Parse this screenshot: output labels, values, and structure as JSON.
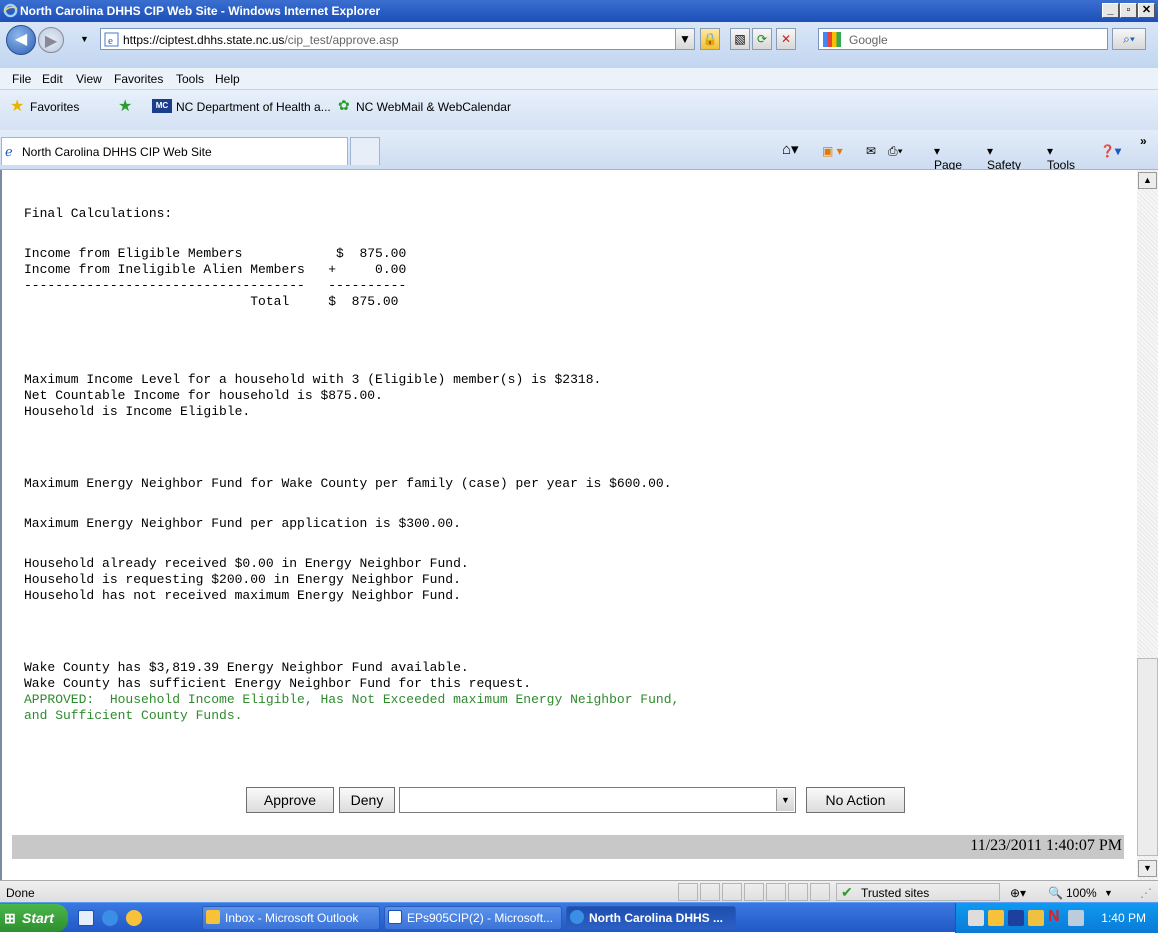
{
  "window": {
    "title": "North Carolina DHHS CIP Web Site - Windows Internet Explorer"
  },
  "navbar": {
    "url_host": "https://ciptest.dhhs.state.nc.us",
    "url_path": "/cip_test/approve.asp",
    "search_placeholder": "Google"
  },
  "menu": [
    "File",
    "Edit",
    "View",
    "Favorites",
    "Tools",
    "Help"
  ],
  "favorites": {
    "label": "Favorites",
    "links": [
      "NC Department of Health a...",
      "NC WebMail & WebCalendar"
    ]
  },
  "tabs": {
    "active": "North Carolina DHHS CIP Web Site"
  },
  "commandbar": {
    "page": "Page",
    "safety": "Safety",
    "tools": "Tools"
  },
  "content": {
    "header": "Final Calculations:",
    "table": "Income from Eligible Members            $  875.00\nIncome from Ineligible Alien Members   +     0.00\n------------------------------------   ----------\n                             Total     $  875.00",
    "eligibility": "Maximum Income Level for a household with 3 (Eligible) member(s) is $2318.\nNet Countable Income for household is $875.00.\nHousehold is Income Eligible.",
    "county_max": "Maximum Energy Neighbor Fund for Wake County per family (case) per year is $600.00.",
    "app_max": "Maximum Energy Neighbor Fund per application is $300.00.",
    "received": "Household already received $0.00 in Energy Neighbor Fund.\nHousehold is requesting $200.00 in Energy Neighbor Fund.\nHousehold has not received maximum Energy Neighbor Fund.",
    "county_funds": "Wake County has $3,819.39 Energy Neighbor Fund available.\nWake County has sufficient Energy Neighbor Fund for this request.",
    "approved": "APPROVED:  Household Income Eligible, Has Not Exceeded maximum Energy Neighbor Fund,\nand Sufficient County Funds.",
    "approved_color": "#2e8b2e"
  },
  "actions": {
    "approve": "Approve",
    "deny": "Deny",
    "deny_reason": "",
    "no_action": "No Action"
  },
  "footer": {
    "timestamp": "11/23/2011 1:40:07 PM"
  },
  "status": {
    "text": "Done",
    "zone": "Trusted sites",
    "zoom": "100%"
  },
  "taskbar": {
    "start": "Start",
    "tasks": [
      "Inbox - Microsoft Outlook",
      "EPs905CIP(2) - Microsoft...",
      "North Carolina DHHS ..."
    ],
    "clock": "1:40 PM"
  }
}
